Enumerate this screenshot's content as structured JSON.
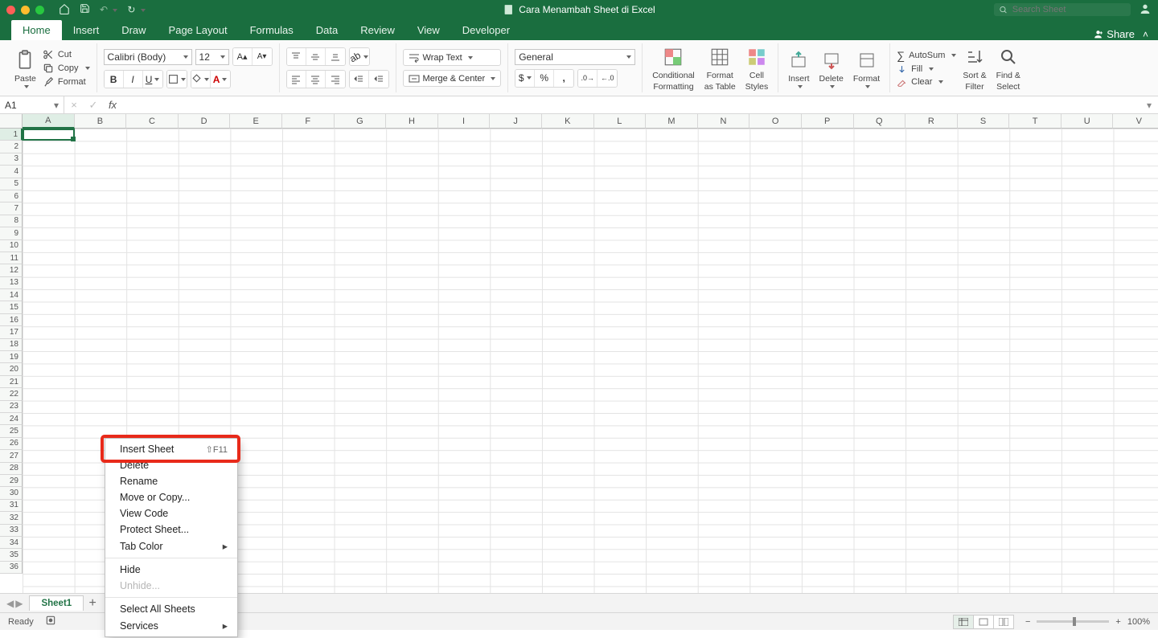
{
  "window": {
    "title": "Cara Menambah Sheet di Excel"
  },
  "search": {
    "placeholder": "Search Sheet"
  },
  "tabs": {
    "items": [
      "Home",
      "Insert",
      "Draw",
      "Page Layout",
      "Formulas",
      "Data",
      "Review",
      "View",
      "Developer"
    ],
    "share": "Share"
  },
  "ribbon": {
    "paste": "Paste",
    "cut": "Cut",
    "copy": "Copy",
    "format_painter": "Format",
    "font_name": "Calibri (Body)",
    "font_size": "12",
    "wrap": "Wrap Text",
    "merge": "Merge & Center",
    "number_format": "General",
    "cond_fmt_l1": "Conditional",
    "cond_fmt_l2": "Formatting",
    "fmt_table_l1": "Format",
    "fmt_table_l2": "as Table",
    "cell_styles_l1": "Cell",
    "cell_styles_l2": "Styles",
    "insert": "Insert",
    "delete": "Delete",
    "format": "Format",
    "autosum": "AutoSum",
    "fill": "Fill",
    "clear": "Clear",
    "sort_l1": "Sort &",
    "sort_l2": "Filter",
    "find_l1": "Find &",
    "find_l2": "Select"
  },
  "namebox": {
    "ref": "A1"
  },
  "columns": [
    "A",
    "B",
    "C",
    "D",
    "E",
    "F",
    "G",
    "H",
    "I",
    "J",
    "K",
    "L",
    "M",
    "N",
    "O",
    "P",
    "Q",
    "R",
    "S",
    "T",
    "U",
    "V"
  ],
  "rows": 36,
  "sheet_tab": "Sheet1",
  "status": {
    "ready": "Ready",
    "zoom": "100%"
  },
  "ctx": {
    "insert_sheet": "Insert Sheet",
    "insert_shortcut": "⇧F11",
    "delete": "Delete",
    "rename": "Rename",
    "move": "Move or Copy...",
    "view_code": "View Code",
    "protect": "Protect Sheet...",
    "tab_color": "Tab Color",
    "hide": "Hide",
    "unhide": "Unhide...",
    "select_all": "Select All Sheets",
    "services": "Services"
  }
}
